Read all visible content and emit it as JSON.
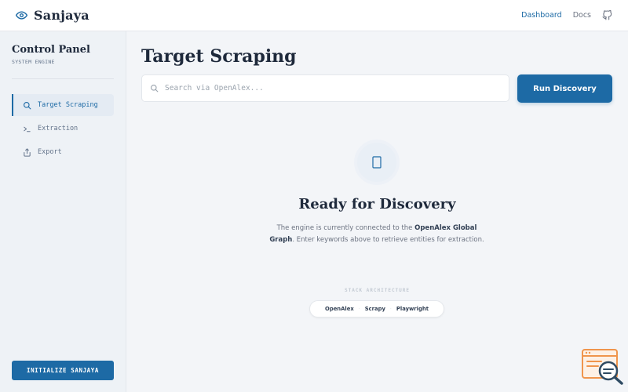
{
  "header": {
    "brand_name": "Sanjaya",
    "nav": [
      {
        "label": "Dashboard",
        "active": true
      },
      {
        "label": "Docs",
        "active": false
      }
    ],
    "icons": {
      "brand": "eye-icon",
      "github": "github-icon"
    }
  },
  "sidebar": {
    "title": "Control Panel",
    "subtitle": "SYSTEM ENGINE",
    "items": [
      {
        "label": "Target Scraping",
        "icon": "search-icon",
        "active": true
      },
      {
        "label": "Extraction",
        "icon": "terminal-icon",
        "active": false
      },
      {
        "label": "Export",
        "icon": "share-icon",
        "active": false
      }
    ],
    "init_button": "INITIALIZE SANJAYA"
  },
  "main": {
    "title": "Target Scraping",
    "search": {
      "placeholder": "Search via OpenAlex...",
      "value": ""
    },
    "run_button": "Run Discovery",
    "empty_state": {
      "icon": "document-icon",
      "title": "Ready for Discovery",
      "desc_pre": "The engine is currently connected to the ",
      "desc_bold": "OpenAlex Global Graph",
      "desc_post": ". Enter keywords above to retrieve entities for extraction."
    },
    "stack": {
      "label": "STACK ARCHITECTURE",
      "items": [
        "OpenAlex",
        "Scrapy",
        "Playwright"
      ]
    }
  },
  "colors": {
    "accent": "#1d6aa5",
    "sidebar_bg": "#eef2f6",
    "page_bg": "#f3f5f8",
    "text_dark": "#1e293b"
  }
}
